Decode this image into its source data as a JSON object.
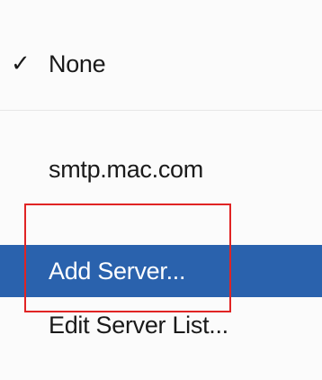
{
  "menu": {
    "items": [
      {
        "label": "None",
        "checked": true,
        "check_glyph": "✓"
      },
      {
        "label": "smtp.mac.com",
        "checked": false
      },
      {
        "label": "Add Server...",
        "checked": false,
        "highlighted": true
      },
      {
        "label": "Edit Server List...",
        "checked": false
      }
    ]
  },
  "colors": {
    "selection": "#2a62ad",
    "annotation_box": "#e02424"
  }
}
